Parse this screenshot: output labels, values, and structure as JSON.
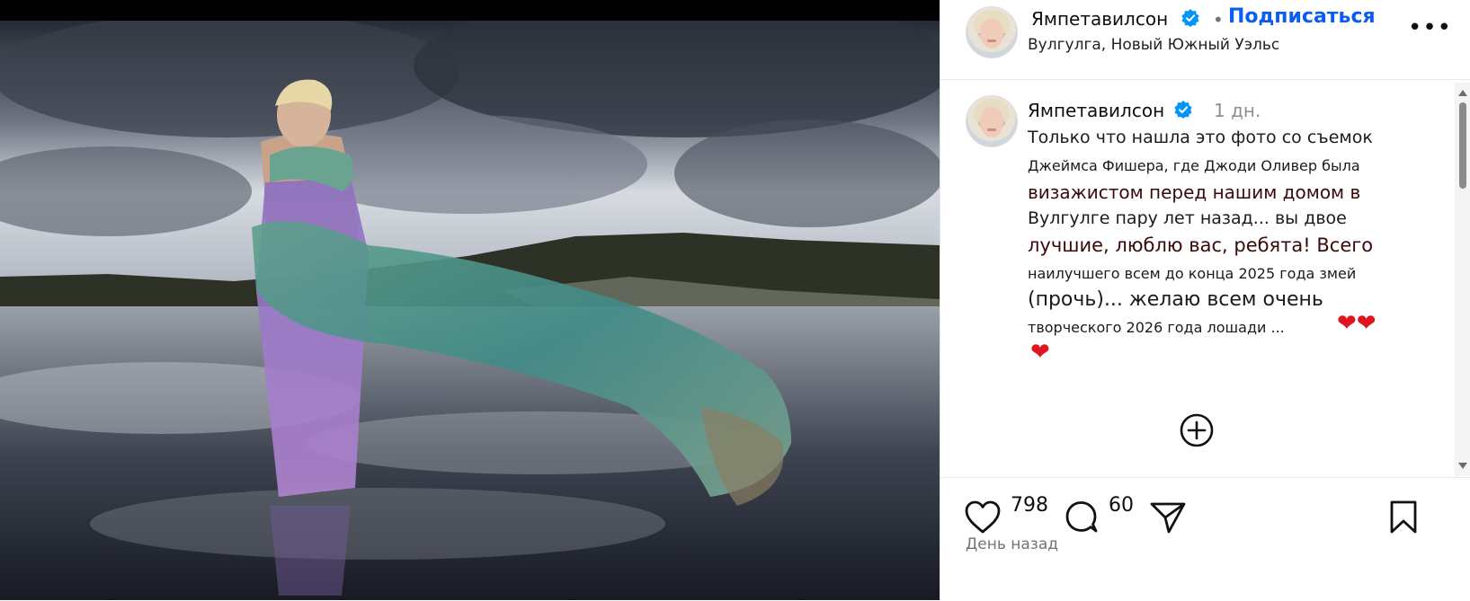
{
  "post": {
    "username": "Ямпетавилсон",
    "follow_label": "Подписаться",
    "location": "Вулгулга, Новый Южный Уэльс",
    "more_label": "•••"
  },
  "comment": {
    "username": "Ямпетавилсон",
    "time": "1 дн.",
    "caption_lines": [
      "Только что нашла это фото со съемок",
      "Джеймса Фишера, где Джоди Оливер была",
      "визажистом перед нашим домом в",
      "Вулгулге пару лет назад... вы двое",
      "лучшие, люблю вас, ребята! Всего",
      "наилучшего всем до конца 2025 года змей",
      "(прочь)... желаю всем очень",
      "творческого 2026 года лошади     ..."
    ],
    "hearts_line1": "❤❤",
    "hearts_line2": "❤"
  },
  "actions": {
    "likes": "798",
    "comments": "60",
    "posted": "День назад"
  },
  "colors": {
    "accent_blue": "#0a5cf5",
    "verified_blue": "#0095f6",
    "heart_red": "#e0141e"
  },
  "icons": [
    "heart-icon",
    "comment-icon",
    "share-icon",
    "bookmark-icon",
    "plus-circle-icon",
    "verified-badge-icon",
    "more-icon"
  ]
}
